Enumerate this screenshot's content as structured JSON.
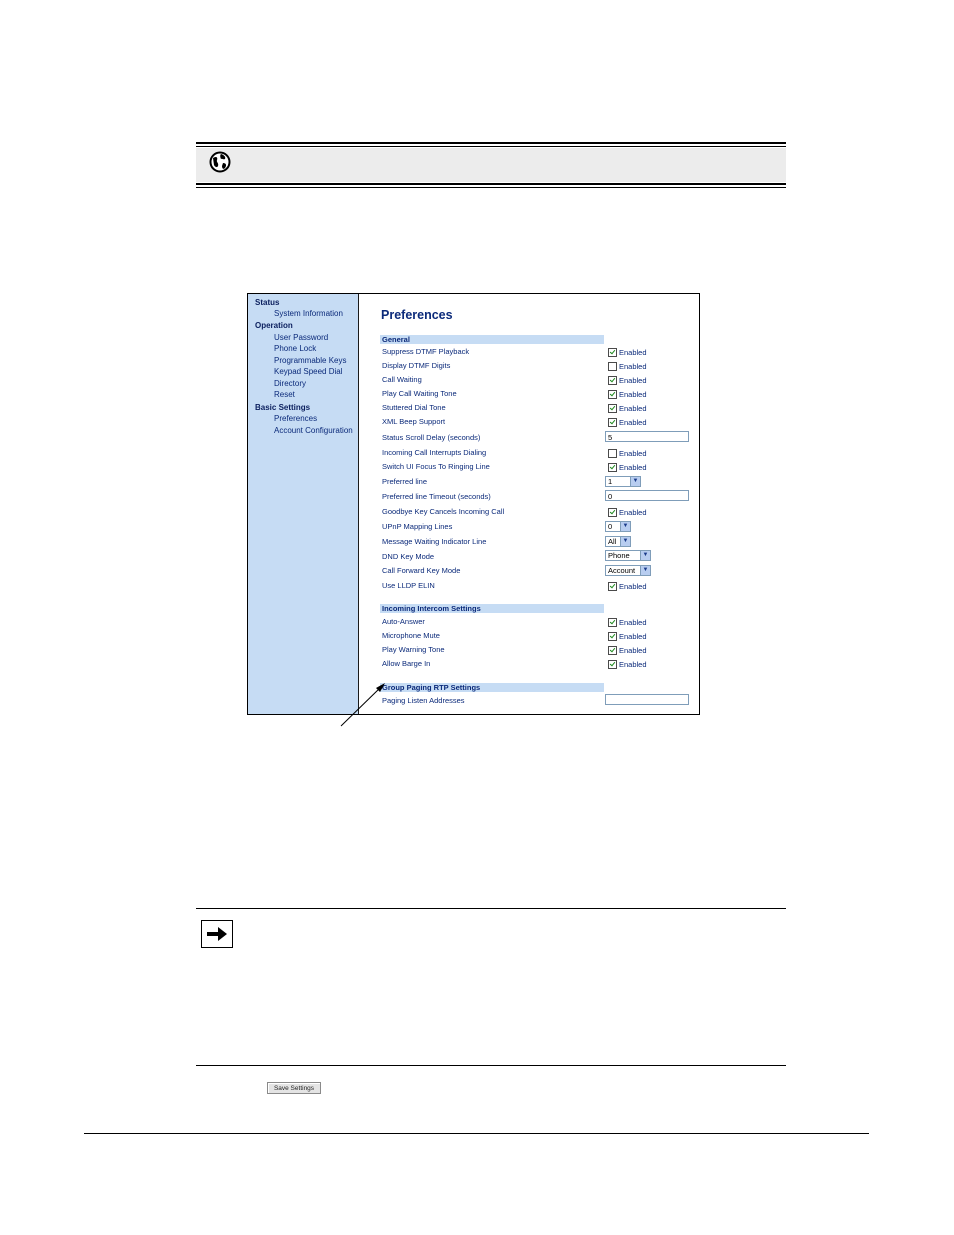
{
  "sidebar": {
    "status_heading": "Status",
    "system_information": "System Information",
    "operation_heading": "Operation",
    "user_password": "User Password",
    "phone_lock": "Phone Lock",
    "programmable_keys": "Programmable Keys",
    "keypad_speed_dial": "Keypad Speed Dial",
    "directory": "Directory",
    "reset": "Reset",
    "basic_settings_heading": "Basic Settings",
    "preferences": "Preferences",
    "account_configuration": "Account Configuration"
  },
  "page": {
    "title": "Preferences"
  },
  "general": {
    "heading": "General",
    "suppress_dtmf": {
      "label": "Suppress DTMF Playback",
      "text": "Enabled",
      "checked": true
    },
    "display_dtmf": {
      "label": "Display DTMF Digits",
      "text": "Enabled",
      "checked": false
    },
    "call_waiting": {
      "label": "Call Waiting",
      "text": "Enabled",
      "checked": true
    },
    "play_call_waiting_tone": {
      "label": "Play Call Waiting Tone",
      "text": "Enabled",
      "checked": true
    },
    "stuttered_dial_tone": {
      "label": "Stuttered Dial Tone",
      "text": "Enabled",
      "checked": true
    },
    "xml_beep_support": {
      "label": "XML Beep Support",
      "text": "Enabled",
      "checked": true
    },
    "status_scroll_delay": {
      "label": "Status Scroll Delay (seconds)",
      "value": "5"
    },
    "incoming_call_interrupts": {
      "label": "Incoming Call Interrupts Dialing",
      "text": "Enabled",
      "checked": false
    },
    "switch_ui_focus": {
      "label": "Switch UI Focus To Ringing Line",
      "text": "Enabled",
      "checked": true
    },
    "preferred_line": {
      "label": "Preferred line",
      "value": "1"
    },
    "preferred_line_timeout": {
      "label": "Preferred line Timeout (seconds)",
      "value": "0"
    },
    "goodbye_key_cancels": {
      "label": "Goodbye Key Cancels Incoming Call",
      "text": "Enabled",
      "checked": true
    },
    "upnp_mapping_lines": {
      "label": "UPnP Mapping Lines",
      "value": "0"
    },
    "message_waiting_indicator": {
      "label": "Message Waiting Indicator Line",
      "value": "All"
    },
    "dnd_key_mode": {
      "label": "DND Key Mode",
      "value": "Phone"
    },
    "call_forward_key_mode": {
      "label": "Call Forward Key Mode",
      "value": "Account"
    },
    "use_lldp_elin": {
      "label": "Use LLDP ELIN",
      "text": "Enabled",
      "checked": true
    }
  },
  "intercom": {
    "heading": "Incoming Intercom Settings",
    "auto_answer": {
      "label": "Auto-Answer",
      "text": "Enabled",
      "checked": true
    },
    "microphone_mute": {
      "label": "Microphone Mute",
      "text": "Enabled",
      "checked": true
    },
    "play_warning_tone": {
      "label": "Play Warning Tone",
      "text": "Enabled",
      "checked": true
    },
    "allow_barge_in": {
      "label": "Allow Barge In",
      "text": "Enabled",
      "checked": true
    }
  },
  "paging": {
    "heading": "Group Paging RTP Settings",
    "listen_addresses": {
      "label": "Paging Listen Addresses",
      "value": ""
    }
  },
  "save_button": "Save Settings",
  "icons": {
    "header": "globe-icon",
    "note": "arrow-right-icon",
    "pointer": "callout-arrow"
  }
}
